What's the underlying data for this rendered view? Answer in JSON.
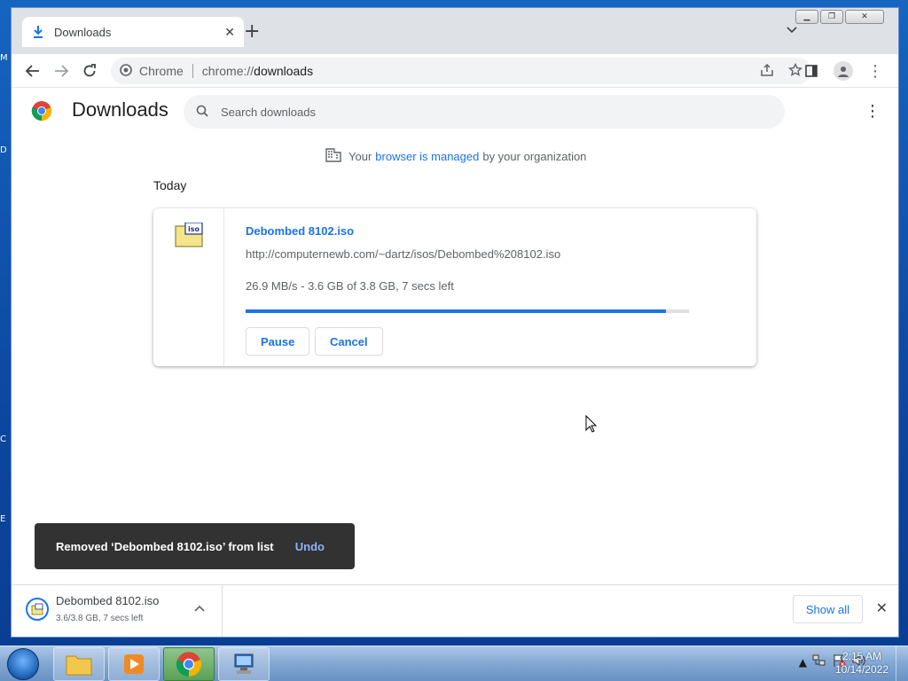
{
  "browser": {
    "tab": {
      "title": "Downloads",
      "icon": "download-icon"
    },
    "omnibox": {
      "chip": "Chrome",
      "url_scheme": "chrome://",
      "url_path": "downloads"
    }
  },
  "page": {
    "title": "Downloads",
    "search_placeholder": "Search downloads",
    "managed": {
      "prefix": "Your",
      "link": "browser is managed",
      "suffix": "by your organization"
    },
    "section": "Today"
  },
  "download": {
    "name": "Debombed 8102.iso",
    "url": "http://computernewb.com/~dartz/isos/Debombed%208102.iso",
    "status": "26.9 MB/s - 3.6 GB of 3.8 GB, 7 secs left",
    "progress_fraction": 0.947,
    "pause_label": "Pause",
    "cancel_label": "Cancel"
  },
  "toast": {
    "message": "Removed ‘Debombed 8102.iso’ from list",
    "undo_label": "Undo"
  },
  "shelf": {
    "name": "Debombed 8102.iso",
    "sub": "3.6/3.8 GB, 7 secs left",
    "show_all_label": "Show all"
  },
  "taskbar": {
    "time": "2:15 AM",
    "date": "10/14/2022"
  },
  "colors": {
    "accent": "#1a73e8",
    "toast_bg": "#323232",
    "undo": "#8ab4f8"
  }
}
